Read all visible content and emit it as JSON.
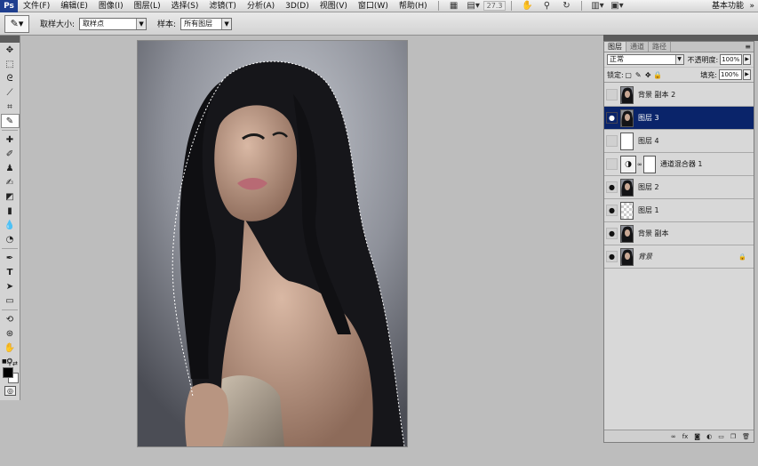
{
  "app": {
    "logo": "Ps"
  },
  "menu": {
    "items": [
      "文件(F)",
      "编辑(E)",
      "图像(I)",
      "图层(L)",
      "选择(S)",
      "滤镜(T)",
      "分析(A)",
      "3D(D)",
      "视图(V)",
      "窗口(W)",
      "帮助(H)"
    ],
    "zoom": "27.3",
    "workspace": "基本功能",
    "icons": [
      "bridge-icon",
      "mini-bridge-icon",
      "hand-icon",
      "zoom-icon",
      "rotate-icon",
      "arrange-icon",
      "screen-mode-icon"
    ]
  },
  "options": {
    "sample_size_label": "取样大小:",
    "sample_size_value": "取样点",
    "sample_label": "样本:",
    "sample_value": "所有图层"
  },
  "layers_panel": {
    "tabs": [
      "图层",
      "通道",
      "路径"
    ],
    "blend_mode": "正常",
    "opacity_label": "不透明度:",
    "opacity": "100%",
    "lock_label": "锁定:",
    "fill_label": "填充:",
    "fill": "100%",
    "layers": [
      {
        "name": "背景 副本 2",
        "visible": false,
        "thumb": "photo",
        "selected": false
      },
      {
        "name": "图层 3",
        "visible": true,
        "thumb": "photo",
        "selected": true
      },
      {
        "name": "图层 4",
        "visible": false,
        "thumb": "white",
        "selected": false
      },
      {
        "name": "通道混合器 1",
        "visible": false,
        "thumb": "adjustment",
        "selected": false
      },
      {
        "name": "图层 2",
        "visible": true,
        "thumb": "photo",
        "selected": false
      },
      {
        "name": "图层 1",
        "visible": true,
        "thumb": "transparent",
        "selected": false
      },
      {
        "name": "背景 副本",
        "visible": true,
        "thumb": "photo",
        "selected": false
      },
      {
        "name": "背景",
        "visible": true,
        "thumb": "photo",
        "selected": false,
        "italic": true,
        "locked": true
      }
    ]
  },
  "colors": {
    "selected_layer": "#0a246a",
    "foreground": "#000000",
    "background": "#ffffff"
  }
}
